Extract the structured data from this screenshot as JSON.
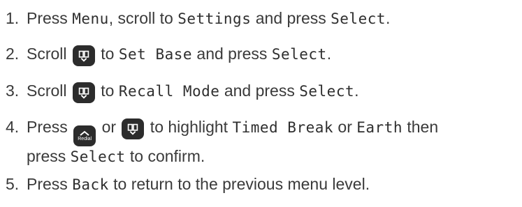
{
  "steps": [
    {
      "num": "1.",
      "a": "Press ",
      "b": "Menu",
      "c": ", scroll  to ",
      "d": "Settings",
      "e": " and press ",
      "f": "Select",
      "g": "."
    },
    {
      "num": "2.",
      "a": "Scroll ",
      "b": " to ",
      "c": "Set Base",
      "d": " and press ",
      "e": "Select",
      "f": "."
    },
    {
      "num": "3.",
      "a": "Scroll ",
      "b": " to ",
      "c": "Recall Mode",
      "d": " and press ",
      "e": "Select",
      "f": "."
    },
    {
      "num": "4.",
      "a": "Press ",
      "b": " or ",
      "c": " to highlight ",
      "d": "Timed Break",
      "e": " or ",
      "f": "Earth",
      "g": " then",
      "h": "press ",
      "i": "Select",
      "j": " to confirm."
    },
    {
      "num": "5.",
      "a": "Press ",
      "b": "Back",
      "c": " to return to the previous menu level."
    }
  ],
  "icons": {
    "nav": "phonebook-scroll-icon",
    "redial": "redial-up-icon",
    "redial_label": "Redial"
  }
}
